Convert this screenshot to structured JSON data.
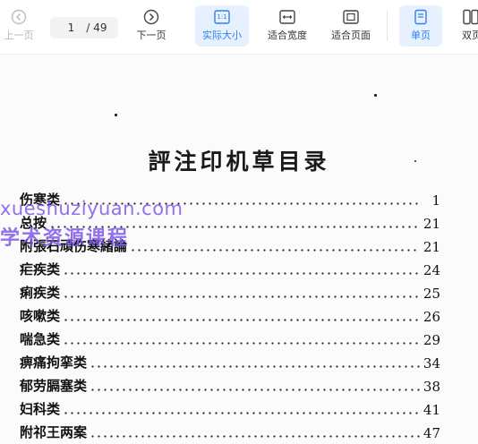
{
  "toolbar": {
    "prev_label": "上一页",
    "current_page": "1",
    "total_pages": "/ 49",
    "next_label": "下一页",
    "actual_size_label": "实际大小",
    "actual_size_icon_text": "1:1",
    "fit_width_label": "适合宽度",
    "fit_page_label": "适合页面",
    "single_page_label": "单页",
    "double_page_label": "双页"
  },
  "document": {
    "title": "評注印机草目录",
    "toc": [
      {
        "title": "伤寒类",
        "page": "1"
      },
      {
        "title": "总按",
        "page": "21"
      },
      {
        "title": "附張石頑伤寒緒論",
        "page": "21"
      },
      {
        "title": "疟疾类",
        "page": "24"
      },
      {
        "title": "痢疾类",
        "page": "25"
      },
      {
        "title": "咳嗽类",
        "page": "26"
      },
      {
        "title": "喘急类",
        "page": "29"
      },
      {
        "title": "痹痛拘挛类",
        "page": "34"
      },
      {
        "title": "郁劳膈塞类",
        "page": "38"
      },
      {
        "title": "妇科类",
        "page": "41"
      },
      {
        "title": "附祁王两案",
        "page": "47"
      }
    ]
  },
  "watermark": {
    "line1": "xueshuziyuan.com",
    "line2": "学术资源课程"
  },
  "colors": {
    "accent": "#2f80ed",
    "active_bg": "#e6f1fd",
    "watermark": "#7850e6"
  }
}
